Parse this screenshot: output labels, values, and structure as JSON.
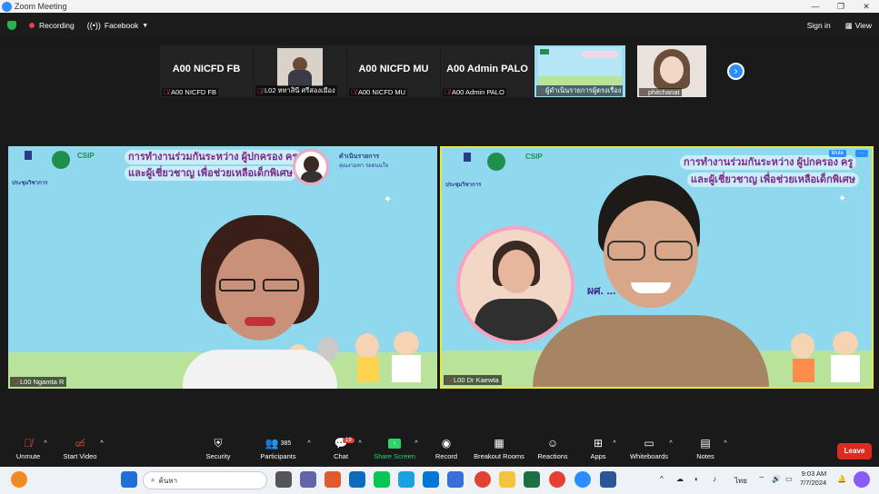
{
  "window": {
    "title": "Zoom Meeting",
    "controls": [
      "—",
      "❐",
      "✕"
    ]
  },
  "topbar": {
    "recording_label": "Recording",
    "facebook_label": "Facebook",
    "signin_label": "Sign in",
    "view_label": "View"
  },
  "thumbnails": [
    {
      "big": "A00 NICFD FB",
      "label": "A00 NICFD FB"
    },
    {
      "big": "",
      "label": "L02 หทาสินี ศรีสองเมือง"
    },
    {
      "big": "A00 NICFD MU",
      "label": "A00 NICFD MU"
    },
    {
      "big": "A00 Admin PALO",
      "label": "A00 Admin PALO"
    },
    {
      "big": "",
      "label": "ผู้ดำเนินรายการผู้ตรงเรื่อง"
    },
    {
      "big": "",
      "label": "phitchanat"
    }
  ],
  "videos": {
    "left": {
      "label": "L00 Ngamta R",
      "title_line1": "การทำงานร่วมกันระหว่าง ผู้ปกครอง ครู",
      "title_line2": "และผู้เชี่ยวชาญ เพื่อช่วยเหลือเด็กพิเศษ",
      "moderator_title": "ดำเนินรายการ",
      "moderator_name": "คุณงามทา รอดนนใจ",
      "csip": "CSIP",
      "meeting": "ประชุมวิชาการ"
    },
    "right": {
      "label": "L00 Dr Kaewta",
      "title_line1": "การทำงานร่วมกันระหว่าง ผู้ปกครอง ครู",
      "title_line2": "และผู้เชี่ยวชาญ เพื่อช่วยเหลือเด็กพิเศษ",
      "speaker_line": "ผศ. ... ณีจารีสเลิศ",
      "csip": "CSIP",
      "meeting": "ประชุมวิชาการ",
      "mute_label": "Mute",
      "more_label": "···"
    }
  },
  "toolbar": {
    "unmute": "Unmute",
    "start_video": "Start Video",
    "security": "Security",
    "participants": "Participants",
    "participants_count": "385",
    "chat": "Chat",
    "chat_badge": "19",
    "share": "Share Screen",
    "record": "Record",
    "breakout": "Breakout Rooms",
    "reactions": "Reactions",
    "apps": "Apps",
    "whiteboards": "Whiteboards",
    "notes": "Notes",
    "leave": "Leave"
  },
  "taskbar": {
    "search_placeholder": "ค้นหา",
    "time": "9:03 AM",
    "date": "7/7/2024",
    "lang": "ไทย"
  },
  "colors": {
    "accent": "#2d8cff",
    "leave": "#e0291f",
    "active_speaker": "#e6e93a"
  }
}
